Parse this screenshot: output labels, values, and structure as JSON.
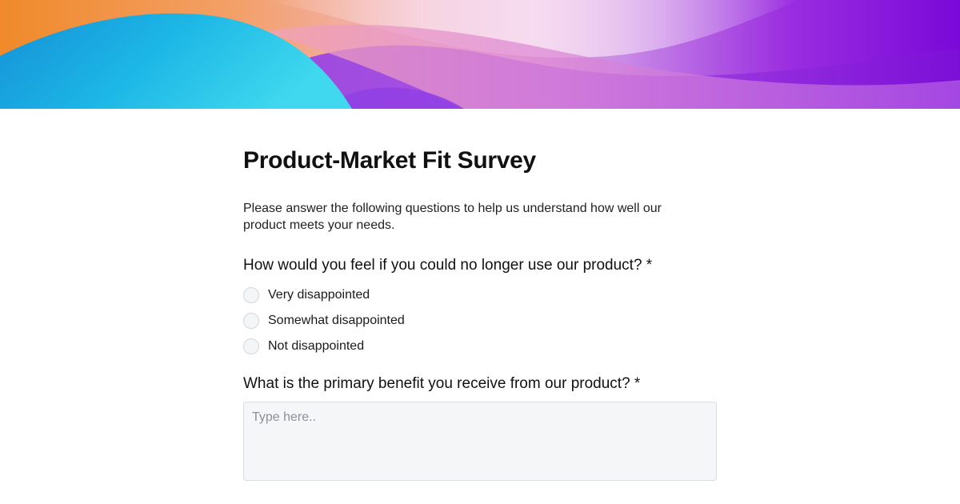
{
  "banner": {
    "colors": {
      "orange": "#f08a2a",
      "blue": "#1aa6e0",
      "cyan": "#36d6ee",
      "pink": "#e88fc8",
      "violet": "#a23ee6",
      "purple": "#7a08d8"
    }
  },
  "form": {
    "title": "Product-Market Fit Survey",
    "intro": "Please answer the following questions to help us understand how well our product meets your needs.",
    "question1": {
      "label": "How would you feel if you could no longer use our product? *",
      "options": [
        {
          "label": "Very disappointed",
          "selected": false
        },
        {
          "label": "Somewhat disappointed",
          "selected": false
        },
        {
          "label": "Not disappointed",
          "selected": false
        }
      ]
    },
    "question2": {
      "label": "What is the primary benefit you receive from our product? *",
      "placeholder": "Type here..",
      "value": ""
    }
  }
}
